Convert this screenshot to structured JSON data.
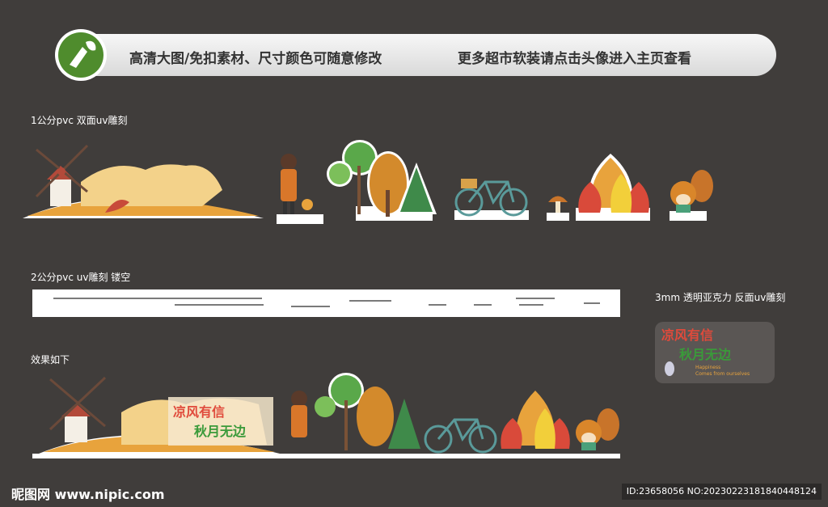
{
  "banner": {
    "text_left": "高清大图/免扣素材、尺寸颜色可随意修改",
    "text_right": "更多超市软装请点击头像进入主页查看"
  },
  "sections": {
    "pvc1": "1公分pvc 双面uv雕刻",
    "pvc2": "2公分pvc   uv雕刻 镂空",
    "acrylic": "3mm 透明亚克力  反面uv雕刻",
    "effect": "效果如下"
  },
  "acrylic_sign": {
    "line1": "凉风有信",
    "line2": "秋月无边",
    "small_en1": "Happiness",
    "small_en2": "Comes from ourselves"
  },
  "footer": {
    "watermark": "昵图网 www.nipic.com",
    "id_text": "ID:23658056 NO:20230223181840448124"
  },
  "colors": {
    "background": "#403d3b",
    "logo_green": "#4f8c2d",
    "autumn_orange": "#e8a33c"
  }
}
